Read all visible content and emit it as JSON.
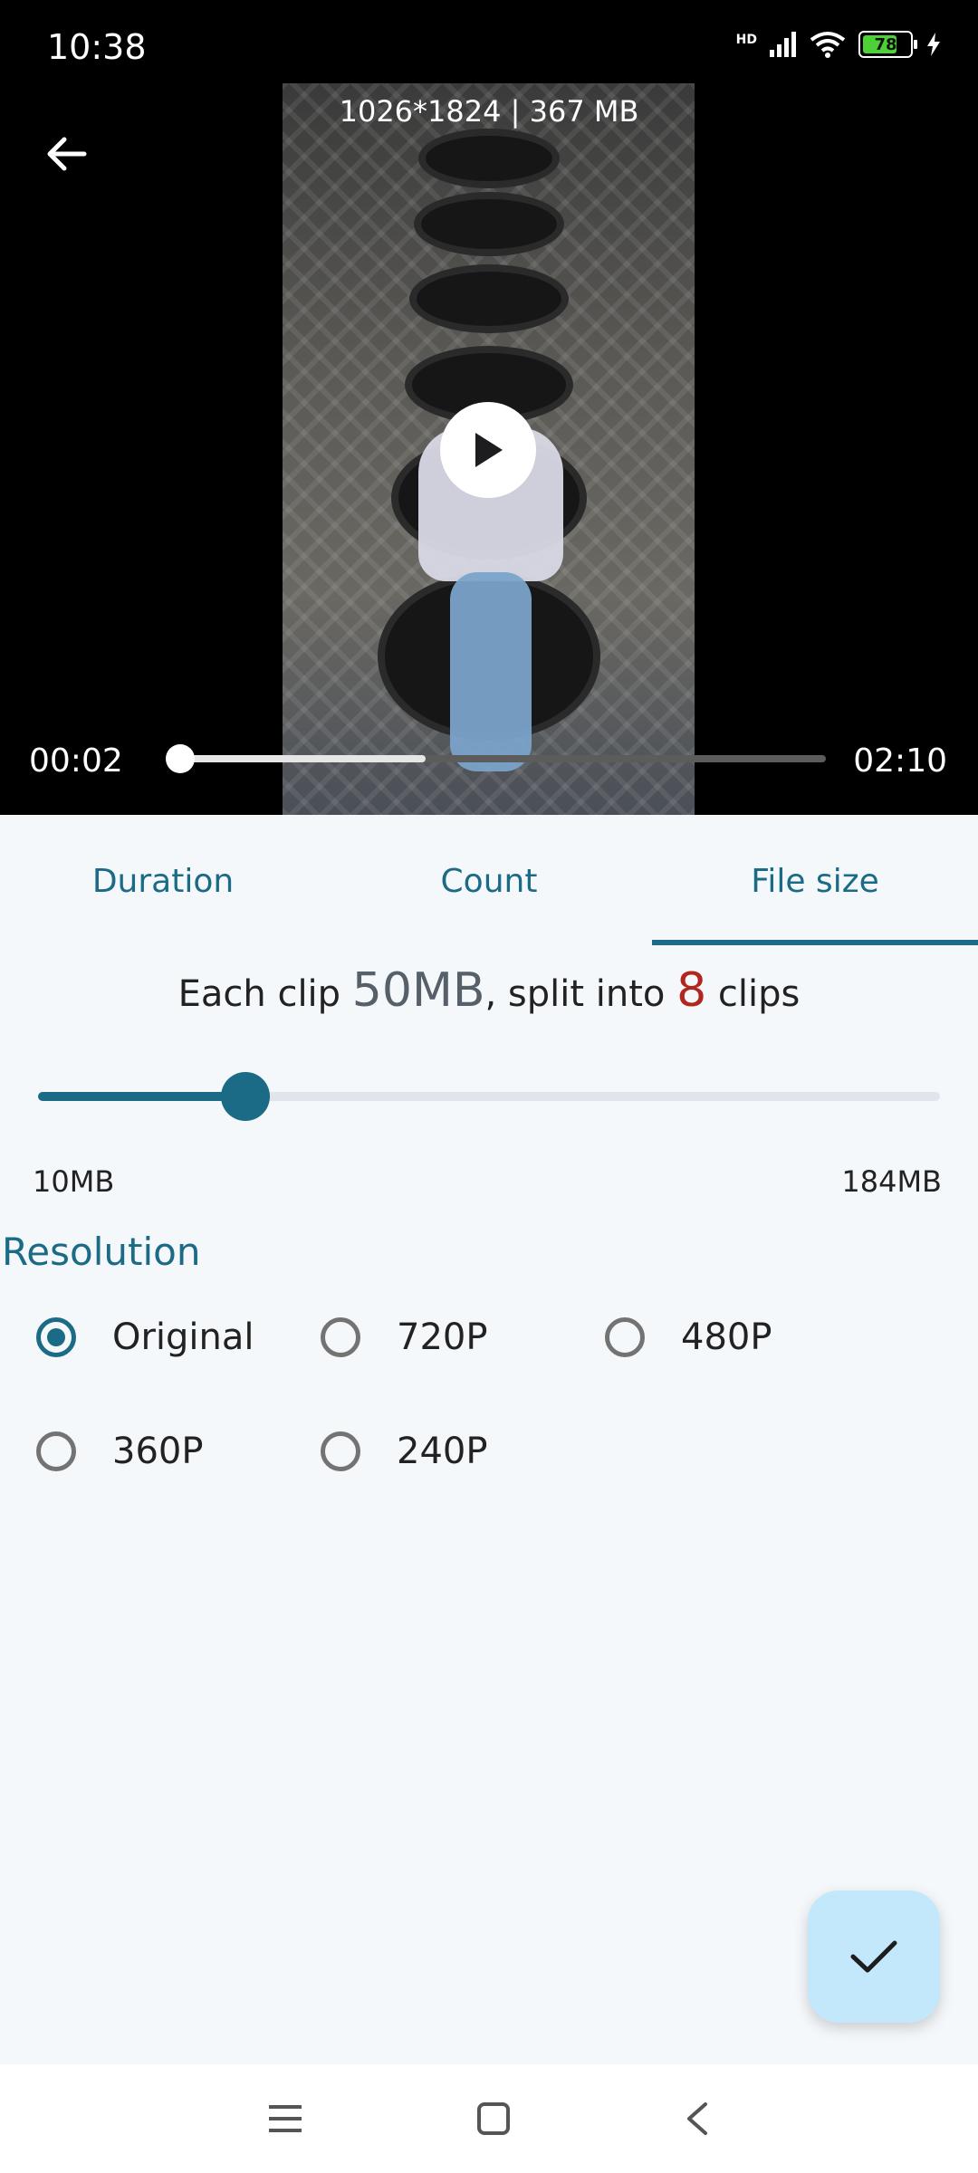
{
  "status_bar": {
    "time": "10:38",
    "network_label": "HD",
    "battery_level": 78,
    "battery_text": "78"
  },
  "video": {
    "info": "1026*1824 | 367 MB",
    "current_time": "00:02",
    "total_time": "02:10",
    "played_fraction": 0.015,
    "buffered_fraction": 0.39
  },
  "tabs": [
    {
      "label": "Duration",
      "active": false
    },
    {
      "label": "Count",
      "active": false
    },
    {
      "label": "File size",
      "active": true
    }
  ],
  "summary": {
    "prefix": "Each clip ",
    "size": "50MB",
    "middle": ", split into ",
    "count": "8",
    "suffix": " clips"
  },
  "size_slider": {
    "min_label": "10MB",
    "max_label": "184MB",
    "min": 10,
    "max": 184,
    "value": 50
  },
  "resolution": {
    "title": "Resolution",
    "options": [
      {
        "label": "Original",
        "checked": true
      },
      {
        "label": "720P",
        "checked": false
      },
      {
        "label": "480P",
        "checked": false
      },
      {
        "label": "360P",
        "checked": false
      },
      {
        "label": "240P",
        "checked": false
      }
    ]
  },
  "icons": {
    "back": "arrow-left-icon",
    "play": "play-icon",
    "confirm": "check-icon",
    "nav_menu": "menu-icon",
    "nav_home": "square-icon",
    "nav_back": "chevron-left-icon"
  },
  "colors": {
    "accent": "#1b6a86",
    "count_highlight": "#b3261e",
    "fab_background": "#c4e8fb"
  }
}
